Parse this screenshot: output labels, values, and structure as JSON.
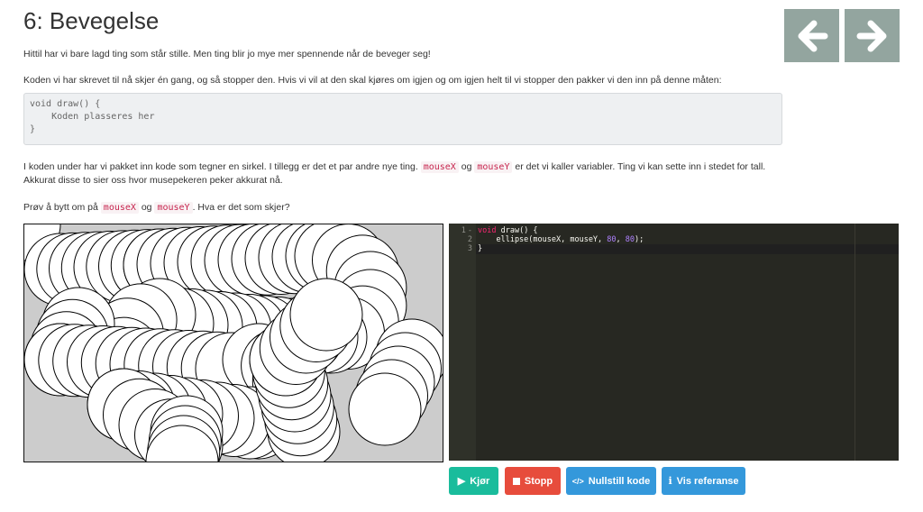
{
  "title": "6: Bevegelse",
  "nav": {
    "prev_icon": "arrow-left-icon",
    "next_icon": "arrow-right-icon",
    "color": "#93a59f"
  },
  "paragraphs": {
    "p1": "Hittil har vi bare lagd ting som står stille. Men ting blir jo mye mer spennende når de beveger seg!",
    "p2": "Koden vi har skrevet til nå skjer én gang, og så stopper den. Hvis vi vil at den skal kjøres om igjen og om igjen helt til vi stopper den pakker vi den inn på denne måten:",
    "p3_before": "I koden under har vi pakket inn kode som tegner en sirkel. I tillegg er det et par andre nye ting.",
    "p3_code1": "mouseX",
    "p3_og": "og",
    "p3_code2": "mouseY",
    "p3_after": "er det vi kaller variabler. Ting vi kan sette inn i stedet for tall. Akkurat disse to sier oss hvor musepekeren peker akkurat nå.",
    "p4_before": "Prøv å bytt om på",
    "p4_code1": "mouseX",
    "p4_og": "og",
    "p4_code2": "mouseY",
    "p4_after": ". Hva er det som skjer?"
  },
  "code_block": "void draw() {\n    Koden plasseres her\n}",
  "editor": {
    "lines": [
      {
        "num": "1",
        "fold": "-"
      },
      {
        "num": "2"
      },
      {
        "num": "3"
      }
    ],
    "line1_kw": "void",
    "line1_rest": " draw() {",
    "line2_fn": "    ellipse(mouseX, mouseY, ",
    "line2_n1": "80",
    "line2_sep": ", ",
    "line2_n2": "80",
    "line2_end": ");",
    "line3": "}"
  },
  "buttons": {
    "run": "Kjør",
    "stop": "Stopp",
    "reset": "Nullstill kode",
    "reference": "Vis referanse",
    "run_color": "#1abc9c",
    "stop_color": "#e74c3c",
    "blue_color": "#3498db"
  }
}
